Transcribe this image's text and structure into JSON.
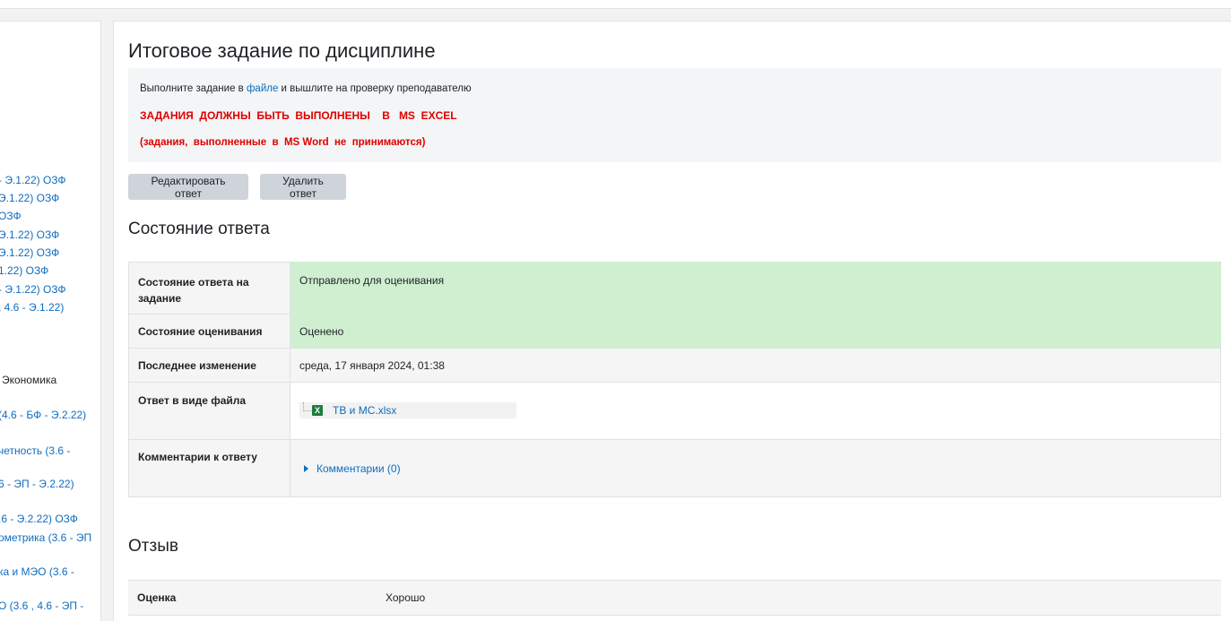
{
  "sidebar": {
    "items": [
      "- Э.1.22) ОЗФ",
      "Э.1.22) ОЗФ",
      "ОЗФ",
      "Э.1.22) ОЗФ",
      "Э.1.22) ОЗФ",
      "1.22) ОЗФ",
      "- Э.1.22) ОЗФ",
      ", 4.6 - Э.1.22)",
      "Экономика",
      "(4.6 - БФ - Э.2.22)",
      "четность (3.6 -",
      "6 - ЭП - Э.2.22)",
      ".6 - Э.2.22) ОЗФ",
      "ометрика (3.6 - ЭП",
      "ка и МЭО (3.6 -",
      "О (3.6 , 4.6 - ЭП -"
    ]
  },
  "page_title": "Итоговое задание по дисциплине",
  "intro": {
    "text_before": "Выполните задание в ",
    "link": "файле",
    "text_after": " и вышлите на проверку преподавателю",
    "red_line1": "ЗАДАНИЯ  ДОЛЖНЫ  БЫТЬ  ВЫПОЛНЕНЫ    В   MS  EXCEL",
    "red_line2": "(задания,  выполненные  в  MS Word  не  принимаются)"
  },
  "buttons": {
    "edit": "Редактировать ответ",
    "delete": "Удалить ответ"
  },
  "status": {
    "heading": "Состояние ответа",
    "rows": [
      {
        "label": "Состояние ответа на задание",
        "value": "Отправлено для оценивания"
      },
      {
        "label": "Состояние оценивания",
        "value": "Оценено"
      },
      {
        "label": "Последнее изменение",
        "value": "среда, 17 января 2024, 01:38"
      },
      {
        "label": "Ответ в виде файла",
        "value": "ТВ и МС.xlsx"
      },
      {
        "label": "Комментарии к ответу",
        "value": "Комментарии (0)"
      }
    ],
    "file_icon": "excel-file-icon",
    "success_color": "#cfefd0"
  },
  "feedback": {
    "heading": "Отзыв",
    "grade_label": "Оценка",
    "grade_value": "Хорошо"
  }
}
